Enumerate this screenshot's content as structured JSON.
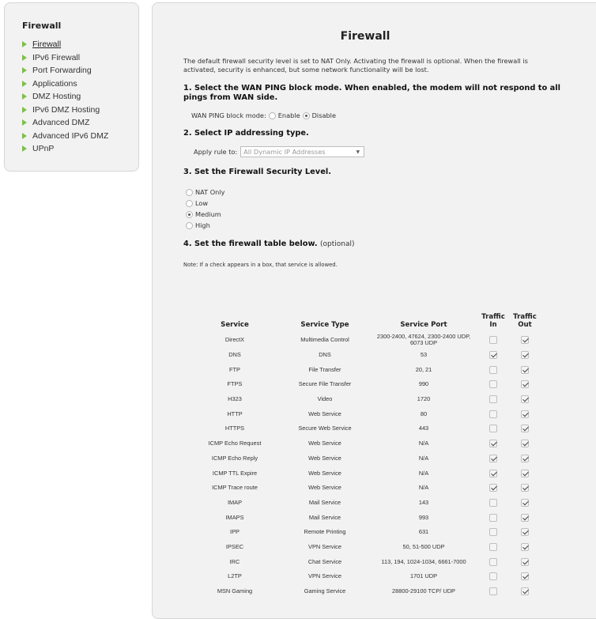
{
  "sidebar": {
    "title": "Firewall",
    "items": [
      {
        "label": "Firewall",
        "active": true
      },
      {
        "label": "IPv6 Firewall"
      },
      {
        "label": "Port Forwarding"
      },
      {
        "label": "Applications"
      },
      {
        "label": "DMZ Hosting"
      },
      {
        "label": "IPv6 DMZ Hosting"
      },
      {
        "label": "Advanced DMZ"
      },
      {
        "label": "Advanced IPv6 DMZ"
      },
      {
        "label": "UPnP"
      }
    ]
  },
  "main": {
    "title": "Firewall",
    "intro": "The default firewall security level is set to NAT Only. Activating the firewall is optional. When the firewall is activated, security is enhanced, but some network functionality will be lost.",
    "step1": {
      "heading": "1. Select the WAN PING block mode. When enabled, the modem will not respond to all pings from WAN side.",
      "label": "WAN PING block mode:",
      "options": [
        "Enable",
        "Disable"
      ],
      "selected": "Disable"
    },
    "step2": {
      "heading": "2. Select IP addressing type.",
      "label": "Apply rule to:",
      "select_value": "All Dynamic IP Addresses"
    },
    "step3": {
      "heading": "3. Set the Firewall Security Level.",
      "levels": [
        "NAT Only",
        "Low",
        "Medium",
        "High"
      ],
      "selected": "Medium"
    },
    "step4": {
      "heading": "4. Set the firewall table below.",
      "optional": "(optional)",
      "note": "Note: If a check appears in a box, that service is allowed."
    },
    "table": {
      "headers": {
        "service": "Service",
        "type": "Service Type",
        "port": "Service Port",
        "in": "Traffic In",
        "out": "Traffic Out"
      },
      "rows": [
        {
          "service": "DirectX",
          "type": "Multimedia Control",
          "port": "2300-2400, 47624, 2300-2400 UDP, 6073 UDP",
          "in": false,
          "out": true
        },
        {
          "service": "DNS",
          "type": "DNS",
          "port": "53",
          "in": true,
          "out": true
        },
        {
          "service": "FTP",
          "type": "File Transfer",
          "port": "20, 21",
          "in": false,
          "out": true
        },
        {
          "service": "FTPS",
          "type": "Secure File Transfer",
          "port": "990",
          "in": false,
          "out": true
        },
        {
          "service": "H323",
          "type": "Video",
          "port": "1720",
          "in": false,
          "out": true
        },
        {
          "service": "HTTP",
          "type": "Web Service",
          "port": "80",
          "in": false,
          "out": true
        },
        {
          "service": "HTTPS",
          "type": "Secure Web Service",
          "port": "443",
          "in": false,
          "out": true
        },
        {
          "service": "ICMP Echo Request",
          "type": "Web Service",
          "port": "N/A",
          "in": true,
          "out": true
        },
        {
          "service": "ICMP Echo Reply",
          "type": "Web Service",
          "port": "N/A",
          "in": true,
          "out": true
        },
        {
          "service": "ICMP TTL Expire",
          "type": "Web Service",
          "port": "N/A",
          "in": true,
          "out": true
        },
        {
          "service": "ICMP Trace route",
          "type": "Web Service",
          "port": "N/A",
          "in": true,
          "out": true
        },
        {
          "service": "IMAP",
          "type": "Mail Service",
          "port": "143",
          "in": false,
          "out": true
        },
        {
          "service": "IMAPS",
          "type": "Mail Service",
          "port": "993",
          "in": false,
          "out": true
        },
        {
          "service": "IPP",
          "type": "Remote Printing",
          "port": "631",
          "in": false,
          "out": true
        },
        {
          "service": "IPSEC",
          "type": "VPN Service",
          "port": "50, 51-500 UDP",
          "in": false,
          "out": true
        },
        {
          "service": "IRC",
          "type": "Chat Service",
          "port": "113, 194, 1024-1034, 6661-7000",
          "in": false,
          "out": true
        },
        {
          "service": "L2TP",
          "type": "VPN Service",
          "port": "1701 UDP",
          "in": false,
          "out": true
        },
        {
          "service": "MSN Gaming",
          "type": "Gaming Service",
          "port": "28800-29100 TCP/ UDP",
          "in": false,
          "out": true
        }
      ]
    }
  },
  "colors": {
    "accent_green": "#7cc242",
    "panel_bg": "#f2f2f2"
  }
}
